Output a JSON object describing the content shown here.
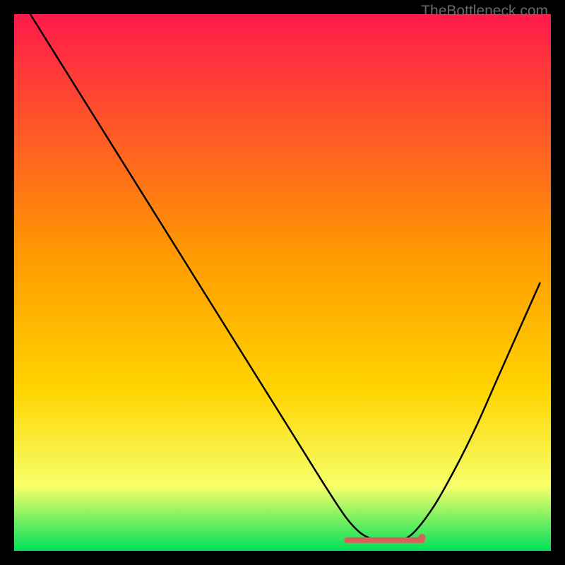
{
  "watermark": "TheBottleneck.com",
  "colors": {
    "gradient_top": "#ff1a4b",
    "gradient_mid": "#ffd400",
    "gradient_low": "#f6ff6a",
    "gradient_bottom": "#00e05a",
    "curve": "#000000",
    "marker": "#d9605a",
    "frame": "#000000"
  },
  "chart_data": {
    "type": "line",
    "title": "",
    "xlabel": "",
    "ylabel": "",
    "xlim": [
      0,
      100
    ],
    "ylim": [
      0,
      100
    ],
    "series": [
      {
        "name": "bottleneck-curve",
        "x": [
          3,
          8,
          13,
          18,
          23,
          28,
          33,
          38,
          43,
          48,
          53,
          58,
          62,
          65,
          68,
          71,
          74,
          78,
          82,
          86,
          90,
          94,
          98
        ],
        "y": [
          100,
          92,
          84,
          76,
          68,
          60,
          52,
          44,
          36,
          28,
          20,
          12,
          6,
          3,
          2,
          2,
          3,
          8,
          15,
          23,
          32,
          41,
          50
        ]
      }
    ],
    "annotations": [
      {
        "name": "optimal-band",
        "shape": "flat-segment",
        "x_start": 62,
        "x_end": 76,
        "y": 2,
        "color": "#d9605a"
      },
      {
        "name": "optimal-point",
        "shape": "dot",
        "x": 76,
        "y": 2.5,
        "color": "#d9605a"
      }
    ],
    "background": {
      "type": "vertical-gradient",
      "stops": [
        {
          "pos": 0,
          "color": "#ff1a4b"
        },
        {
          "pos": 45,
          "color": "#ff9a00"
        },
        {
          "pos": 70,
          "color": "#ffd400"
        },
        {
          "pos": 88,
          "color": "#f6ff6a"
        },
        {
          "pos": 100,
          "color": "#00e05a"
        }
      ]
    }
  }
}
